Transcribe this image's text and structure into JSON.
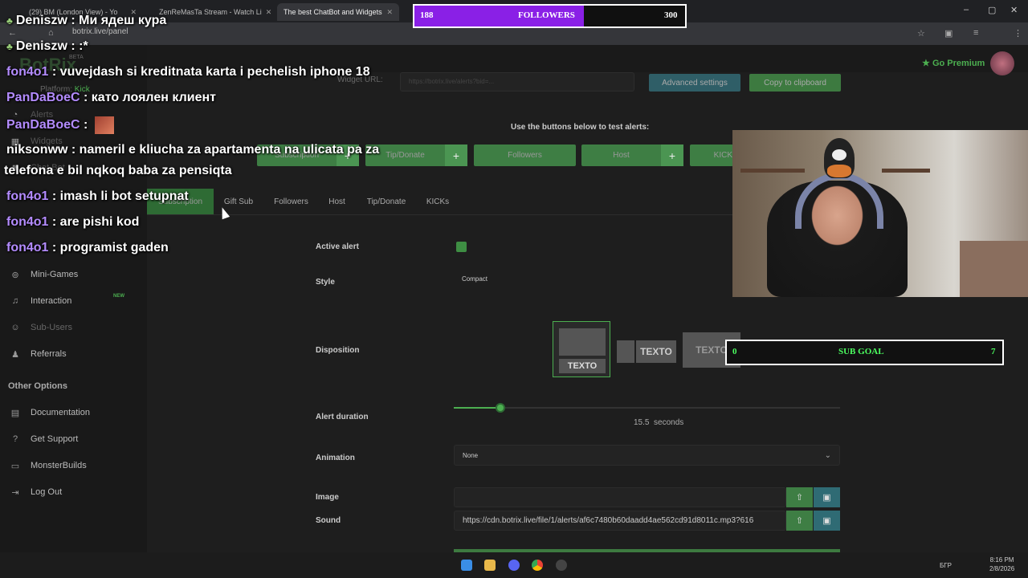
{
  "browser": {
    "tabs": [
      {
        "title": "(29) BM (London View) - Yo"
      },
      {
        "title": "ZenReMasTa Stream - Watch Li"
      },
      {
        "title": "The best ChatBot and Widgets"
      }
    ],
    "url": "botrix.live/panel"
  },
  "app": {
    "brand": "BotRix",
    "beta": "BETA",
    "platform_label": "Platform:",
    "platform": "Kick",
    "go_premium": "Go Premium",
    "widget_url_label": "Widget URL:",
    "widget_url_value": "https://botrix.live/alerts?bid=...",
    "advanced_settings": "Advanced settings",
    "copy_to_clipboard": "Copy to clipboard",
    "test_label": "Use the buttons below to test alerts:",
    "test_buttons": [
      "Subscription",
      "Tip/Donate",
      "Followers",
      "Host",
      "KICKs"
    ]
  },
  "sidebar": {
    "items": [
      {
        "label": "Alerts",
        "icon": "bell-icon"
      },
      {
        "label": "Widgets",
        "icon": "grid-icon"
      },
      {
        "label": "Chat Bot",
        "icon": "robot-icon"
      },
      {
        "label": "Mini-Games",
        "icon": "gamepad-icon"
      },
      {
        "label": "Interaction",
        "icon": "music-icon"
      },
      {
        "label": "Sub-Users",
        "icon": "users-icon"
      },
      {
        "label": "Referrals",
        "icon": "people-icon"
      }
    ],
    "new_badge": "NEW",
    "other_options": "Other Options",
    "other_items": [
      {
        "label": "Documentation",
        "icon": "book-icon"
      },
      {
        "label": "Get Support",
        "icon": "help-icon"
      },
      {
        "label": "MonsterBuilds",
        "icon": "monitor-icon"
      },
      {
        "label": "Log Out",
        "icon": "logout-icon"
      }
    ]
  },
  "alert_tabs": [
    "Subscription",
    "Gift Sub",
    "Followers",
    "Host",
    "Tip/Donate",
    "KICKs"
  ],
  "form": {
    "active_alert_label": "Active alert",
    "style_label": "Style",
    "style_value": "Compact",
    "disposition_label": "Disposition",
    "texto": "TEXTO",
    "alert_duration_label": "Alert duration",
    "alert_duration_value": "15.5",
    "alert_duration_unit": "seconds",
    "alert_duration_fraction": 0.12,
    "animation_label": "Animation",
    "animation_value": "None",
    "image_label": "Image",
    "image_value": "",
    "sound_label": "Sound",
    "sound_value": "https://cdn.botrix.live/file/1/alerts/af6c7480b60daadd4ae562cd91d8011c.mp3?616"
  },
  "overlay": {
    "followers_current": "188",
    "followers_label": "FOLLOWERS",
    "followers_goal": "300",
    "followers_fraction": 0.627,
    "subgoal_current": "0",
    "subgoal_label": "SUB GOAL",
    "subgoal_goal": "7"
  },
  "chat": [
    {
      "user": "Deniszw",
      "msg": " : Ми ядеш кура",
      "badge": true
    },
    {
      "user": "Deniszw",
      "msg": " : :*",
      "badge": true
    },
    {
      "user": "fon4o1",
      "msg": " : vuvejdash si kreditnata karta i pechelish iphone 18"
    },
    {
      "user": "PanDaBoeC",
      "msg": " : като лоялен клиент"
    },
    {
      "user": "PanDaBoeC",
      "msg": " : "
    },
    {
      "user": "niksonww",
      "msg": " : nameril e kliucha za apartamenta na ulicata pa za"
    },
    {
      "user": "",
      "msg": "telefona e bil nqkoq baba za pensiqta"
    },
    {
      "user": "fon4o1",
      "msg": " : imash li bot setupnat"
    },
    {
      "user": "fon4o1",
      "msg": " : are pishi kod"
    },
    {
      "user": "fon4o1",
      "msg": " : programist gaden"
    }
  ],
  "taskbar": {
    "time": "8:16 PM",
    "date": "2/8/2026",
    "lang": "БГР"
  }
}
